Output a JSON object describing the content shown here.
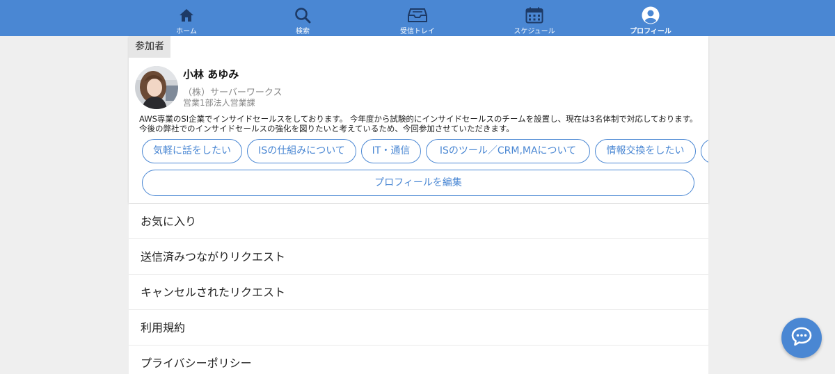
{
  "nav": {
    "items": [
      {
        "label": "ホーム",
        "icon": "home-icon"
      },
      {
        "label": "検索",
        "icon": "search-icon"
      },
      {
        "label": "受信トレイ",
        "icon": "inbox-icon"
      },
      {
        "label": "スケジュール",
        "icon": "calendar-icon"
      },
      {
        "label": "プロフィール",
        "icon": "user-icon",
        "active": true
      }
    ]
  },
  "profile": {
    "section_label": "参加者",
    "name": "小林 あゆみ",
    "company": "（株）サーバーワークス",
    "department": "営業1部法人営業課",
    "bio": "AWS専業のSI企業でインサイドセールスをしております。 今年度から試験的にインサイドセールスのチームを設置し、現在は3名体制で対応しております。 今後の弊社でのインサイドセールスの強化を図りたいと考えているため、今回参加させていただきます。",
    "interests": [
      "気軽に話をしたい",
      "ISの仕組みについて",
      "IT・通信",
      "ISのツール／CRM,MAについて",
      "情報交換をしたい"
    ],
    "edit_label": "プロフィールを編集"
  },
  "menu": {
    "items": [
      "お気に入り",
      "送信済みつながりリクエスト",
      "キャンセルされたリクエスト",
      "利用規約",
      "プライバシーポリシー"
    ]
  },
  "colors": {
    "accent": "#4a87d3",
    "background": "#efefef"
  }
}
